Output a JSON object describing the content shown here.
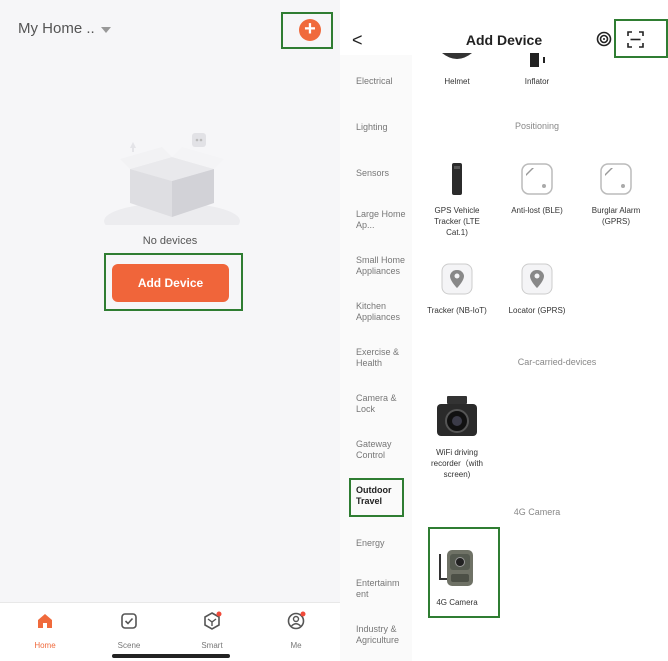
{
  "left": {
    "home_title": "My Home ..",
    "add_symbol": "+",
    "empty_text": "No devices",
    "add_device_button": "Add Device",
    "tabs": [
      {
        "label": "Home",
        "icon": "home-icon"
      },
      {
        "label": "Scene",
        "icon": "scene-icon"
      },
      {
        "label": "Smart",
        "icon": "smart-icon"
      },
      {
        "label": "Me",
        "icon": "me-icon"
      }
    ]
  },
  "right": {
    "back_symbol": "<",
    "title": "Add Device",
    "categories": [
      "Electrical",
      "Lighting",
      "Sensors",
      "Large Home Ap...",
      "Small Home Appliances",
      "Kitchen Appliances",
      "Exercise & Health",
      "Camera & Lock",
      "Gateway Control",
      "Outdoor Travel",
      "Energy",
      "Entertainm ent",
      "Industry & Agriculture"
    ],
    "top_devices": [
      "Helmet",
      "Inflator"
    ],
    "sections": {
      "positioning": "Positioning",
      "car": "Car-carried-devices",
      "camera": "4G Camera"
    },
    "positioning_devices": [
      "GPS Vehicle Tracker (LTE Cat.1)",
      "Anti-lost (BLE)",
      "Burglar Alarm (GPRS)",
      "Tracker (NB-IoT)",
      "Locator (GPRS)"
    ],
    "car_devices": [
      "WiFi driving recorder（with screen)"
    ],
    "camera_devices": [
      "4G Camera"
    ]
  },
  "colors": {
    "accent": "#f06a3c",
    "highlight": "#2f7d32"
  }
}
